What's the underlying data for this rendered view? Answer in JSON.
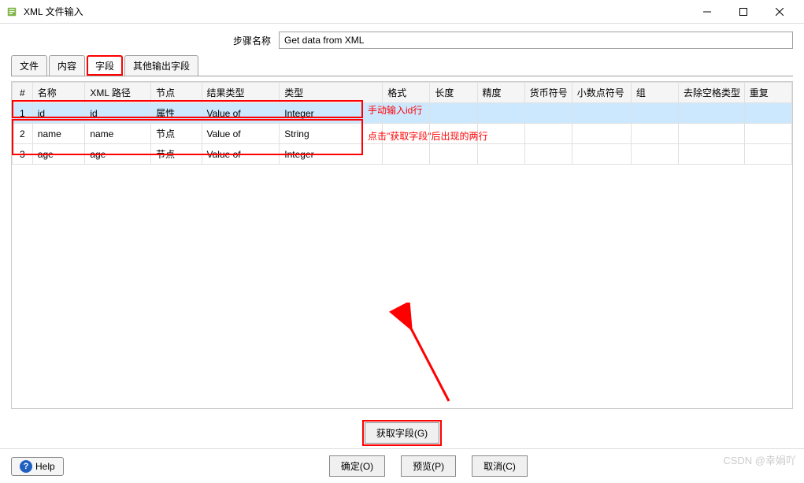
{
  "window": {
    "title": "XML 文件输入"
  },
  "form": {
    "step_label": "步骤名称",
    "step_value": "Get data from XML"
  },
  "tabs": {
    "items": [
      "文件",
      "内容",
      "字段",
      "其他输出字段"
    ],
    "active_index": 2
  },
  "table": {
    "headers": [
      "#",
      "名称",
      "XML 路径",
      "节点",
      "结果类型",
      "类型",
      "格式",
      "长度",
      "精度",
      "货币符号",
      "小数点符号",
      "组",
      "去除空格类型",
      "重复"
    ],
    "rows": [
      {
        "num": "1",
        "name": "id",
        "xml": "id",
        "node": "属性",
        "result": "Value of",
        "type": "Integer",
        "selected": true
      },
      {
        "num": "2",
        "name": "name",
        "xml": "name",
        "node": "节点",
        "result": "Value of",
        "type": "String",
        "selected": false
      },
      {
        "num": "3",
        "name": "age",
        "xml": "age",
        "node": "节点",
        "result": "Value of",
        "type": "Integer",
        "selected": false
      }
    ]
  },
  "annotations": {
    "row1": "手动输入id行",
    "row23": "点击\"获取字段\"后出现的两行"
  },
  "buttons": {
    "get_fields": "获取字段(G)",
    "ok": "确定(O)",
    "preview": "预览(P)",
    "cancel": "取消(C)",
    "help": "Help"
  },
  "watermark": "CSDN @幸娟吖"
}
